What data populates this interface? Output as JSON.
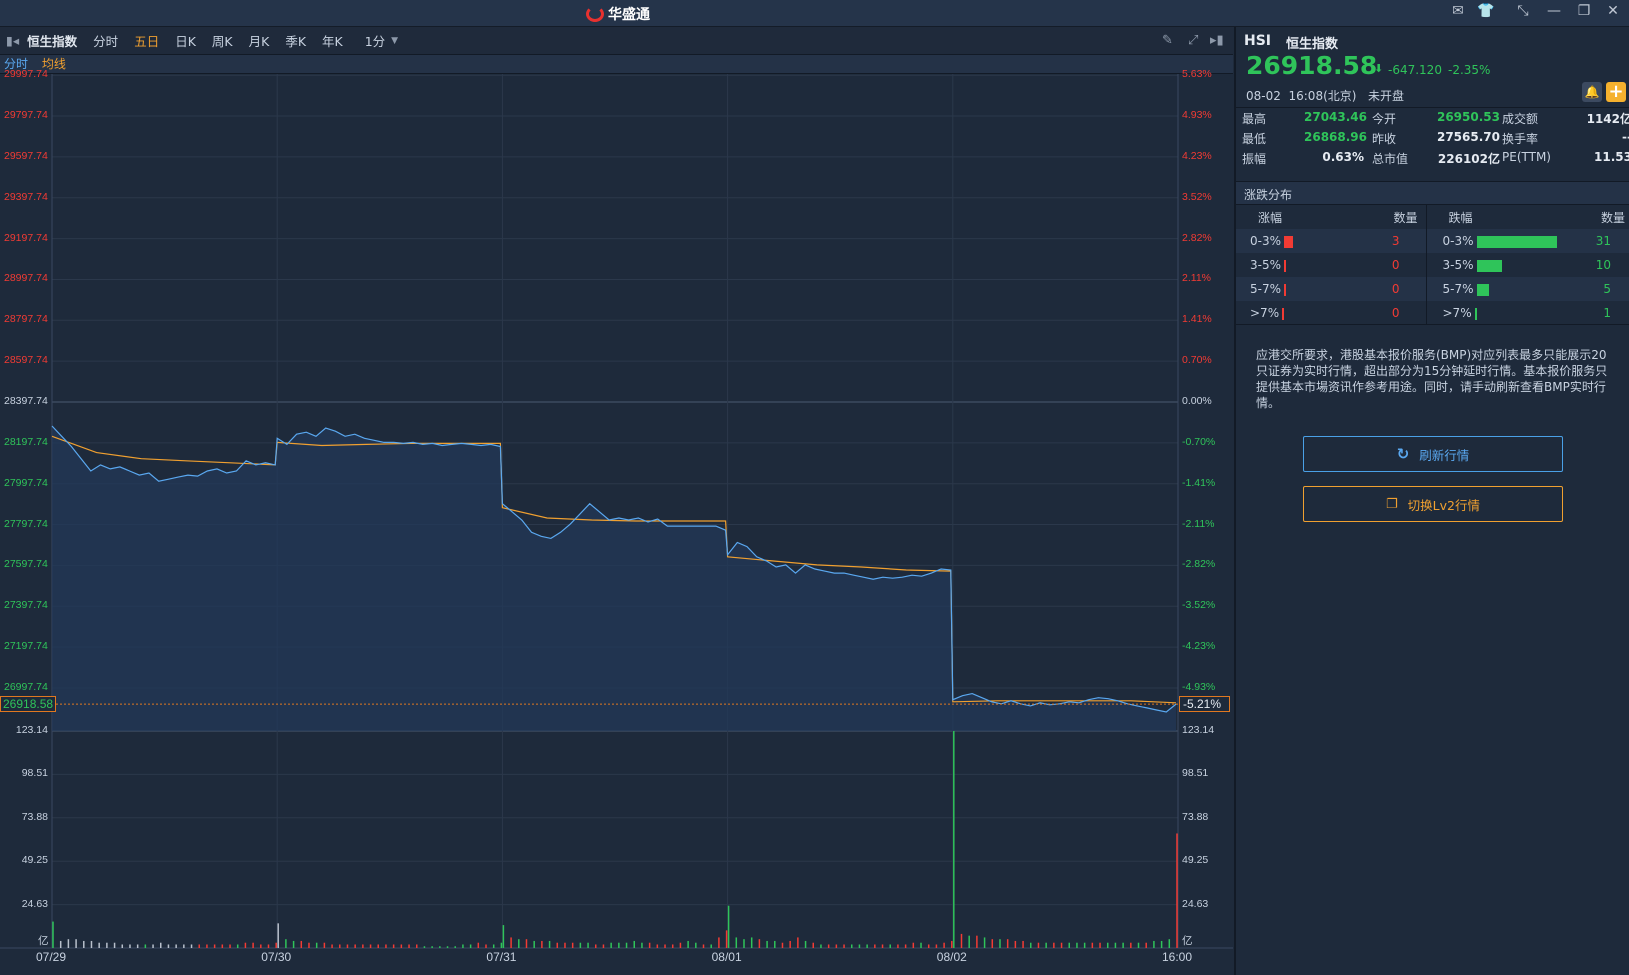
{
  "app": {
    "title": "华盛通"
  },
  "toolbar": {
    "stock_name": "恒生指数",
    "periods": [
      "分时",
      "五日",
      "日K",
      "周K",
      "月K",
      "季K",
      "年K"
    ],
    "active_period": "五日",
    "interval": "1分"
  },
  "subbar": {
    "mode": "分时",
    "indicator": "均线"
  },
  "quote": {
    "code": "HSI",
    "name": "恒生指数",
    "price": "26918.58",
    "change": "-647.120",
    "change_pct": "-2.35%",
    "time": "08-02  16:08(北京)",
    "status": "未开盘",
    "stats": [
      [
        "最高",
        "27043.46",
        "今开",
        "26950.53",
        "成交额",
        "1142亿"
      ],
      [
        "最低",
        "26868.96",
        "昨收",
        "27565.70",
        "换手率",
        "--"
      ],
      [
        "振幅",
        "0.63%",
        "总市值",
        "226102亿",
        "PE(TTM)",
        "11.53"
      ]
    ]
  },
  "distribution": {
    "title": "涨跌分布",
    "headers": [
      "涨幅",
      "数量",
      "跌幅",
      "数量"
    ],
    "rows": [
      {
        "up": "0-3%",
        "up_n": 3,
        "down": "0-3%",
        "down_n": 31
      },
      {
        "up": "3-5%",
        "up_n": 0,
        "down": "3-5%",
        "down_n": 10
      },
      {
        "up": "5-7%",
        "up_n": 0,
        "down": "5-7%",
        "down_n": 5
      },
      {
        "up": ">7%",
        "up_n": 0,
        "down": ">7%",
        "down_n": 1
      }
    ]
  },
  "notice": "应港交所要求，港股基本报价服务(BMP)对应列表最多只能展示20只证券为实时行情，超出部分为15分钟延时行情。基本报价服务只提供基本市場资讯作参考用途。同时，请手动刷新查看BMP实时行情。",
  "buttons": {
    "refresh": "刷新行情",
    "lv2": "切换Lv2行情"
  },
  "colors": {
    "up": "#f23b34",
    "down": "#2fc45a",
    "price_line": "#5aa8f0",
    "avg_line": "#f0a030"
  },
  "chart_data": {
    "type": "line",
    "title": "恒生指数 五日分时",
    "prev_close": 28397.74,
    "current": "26918.58",
    "current_pct": "-5.21%",
    "price_ticks": [
      "29997.74",
      "29797.74",
      "29597.74",
      "29397.74",
      "29197.74",
      "28997.74",
      "28797.74",
      "28597.74",
      "28397.74",
      "28197.74",
      "27997.74",
      "27797.74",
      "27597.74",
      "27397.74",
      "27197.74",
      "26997.74"
    ],
    "pct_ticks": [
      "5.63%",
      "4.93%",
      "4.23%",
      "3.52%",
      "2.82%",
      "2.11%",
      "1.41%",
      "0.70%",
      "0.00%",
      "-0.70%",
      "-1.41%",
      "-2.11%",
      "-2.82%",
      "-3.52%",
      "-4.23%",
      "-4.93%"
    ],
    "vol_ticks": [
      "123.14",
      "98.51",
      "73.88",
      "49.25",
      "24.63"
    ],
    "vol_unit": "亿",
    "x_labels": [
      "07/29",
      "07/30",
      "07/31",
      "08/01",
      "08/02",
      "16:00"
    ],
    "price": [
      [
        28280,
        28230,
        28180,
        28120,
        28060,
        28090,
        28070,
        28080,
        28060,
        28040,
        28050,
        28010,
        28020,
        28030,
        28040,
        28035,
        28060,
        28070,
        28050,
        28060,
        28110,
        28090,
        28100,
        28090
      ],
      [
        28220,
        28190,
        28240,
        28250,
        28230,
        28270,
        28255,
        28230,
        28240,
        28220,
        28210,
        28200,
        28200,
        28195,
        28200,
        28190,
        28195,
        28185,
        28190,
        28195,
        28190,
        28185,
        28190,
        28180
      ],
      [
        27900,
        27860,
        27820,
        27760,
        27740,
        27730,
        27760,
        27800,
        27850,
        27900,
        27860,
        27820,
        27830,
        27820,
        27830,
        27810,
        27825,
        27790,
        27790,
        27790,
        27790,
        27790,
        27790,
        27770
      ],
      [
        27650,
        27710,
        27690,
        27640,
        27620,
        27590,
        27600,
        27560,
        27600,
        27580,
        27570,
        27560,
        27560,
        27550,
        27540,
        27530,
        27540,
        27535,
        27540,
        27550,
        27545,
        27560,
        27580,
        27575
      ],
      [
        26940,
        26960,
        26970,
        26950,
        26930,
        26920,
        26935,
        26920,
        26910,
        26925,
        26915,
        26920,
        26930,
        26925,
        26940,
        26950,
        26945,
        26935,
        26920,
        26910,
        26900,
        26890,
        26880,
        26918.58
      ]
    ],
    "avg": [
      [
        28230,
        28150,
        28120,
        28110,
        28100,
        28090
      ],
      [
        28200,
        28185,
        28190,
        28195,
        28195,
        28195
      ],
      [
        27880,
        27830,
        27820,
        27815,
        27815,
        27815
      ],
      [
        27640,
        27620,
        27600,
        27590,
        27575,
        27570
      ],
      [
        26930,
        26935,
        26935,
        26935,
        26935,
        26925
      ]
    ],
    "volume": [
      [
        15,
        4,
        5,
        5,
        4,
        4,
        3,
        3,
        3,
        2,
        2,
        2,
        2,
        2,
        3,
        2,
        2,
        2,
        2,
        2,
        2,
        2,
        2,
        2,
        2,
        3,
        3,
        2,
        2,
        3
      ],
      [
        14,
        5,
        4,
        4,
        3,
        3,
        3,
        2,
        2,
        2,
        2,
        2,
        2,
        2,
        2,
        2,
        2,
        2,
        2,
        1,
        1,
        1,
        1,
        1,
        2,
        2,
        3,
        2,
        2,
        3
      ],
      [
        13,
        6,
        5,
        5,
        4,
        4,
        4,
        3,
        3,
        3,
        3,
        3,
        2,
        2,
        3,
        3,
        3,
        4,
        3,
        3,
        2,
        2,
        2,
        3,
        4,
        3,
        2,
        2,
        6,
        10
      ],
      [
        24,
        6,
        5,
        6,
        5,
        4,
        4,
        3,
        4,
        6,
        4,
        3,
        2,
        2,
        2,
        2,
        2,
        2,
        2,
        2,
        2,
        2,
        2,
        2,
        3,
        3,
        2,
        2,
        3,
        4
      ],
      [
        123.14,
        8,
        7,
        7,
        6,
        5,
        5,
        5,
        4,
        4,
        3,
        3,
        3,
        3,
        3,
        3,
        3,
        3,
        3,
        3,
        3,
        3,
        3,
        3,
        3,
        3,
        4,
        4,
        5,
        65
      ]
    ],
    "volume_colors": [
      "gwwwwwwwwwwwgwwwwwwrrrrrgrrrrr",
      "wggrrgrrrrrrrrrrrrrgggggggrrgg",
      "grgrgrgrrrggrrgggggrrrrrggrgrr",
      "ggggrggrrrgrgrrrgggrrgrrrgrrrr",
      "grgrgrgrrrgrgrrgggrrgggrgrgggr"
    ],
    "ylim": [
      26918.58,
      29997.74
    ]
  }
}
